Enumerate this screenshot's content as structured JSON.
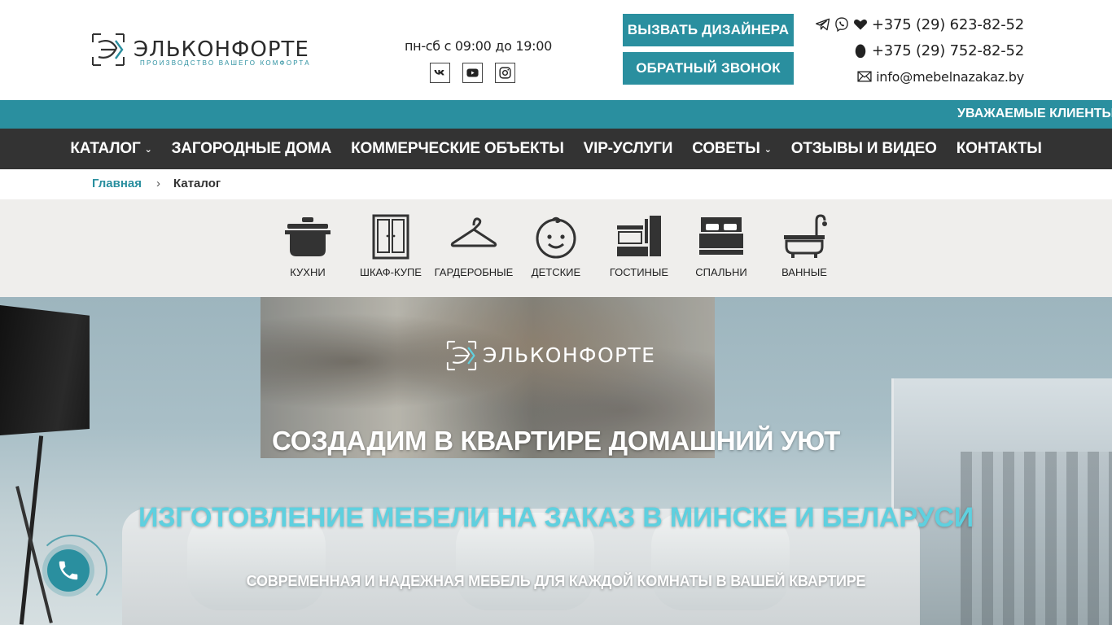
{
  "header": {
    "logo_name": "ЭЛЬКОНФОРТЕ",
    "logo_tagline": "ПРОИЗВОДСТВО ВАШЕГО КОМФОРТА",
    "hours": "пн-сб с 09:00 до 19:00",
    "socials": [
      "vk-icon",
      "youtube-icon",
      "instagram-icon"
    ],
    "cta_designer": "ВЫЗВАТЬ ДИЗАЙНЕРА",
    "cta_callback": "ОБРАТНЫЙ ЗВОНОК",
    "phone1": "+375 (29) 623-82-52",
    "phone2": "+375 (29) 752-82-52",
    "email": "info@mebelnazakaz.by",
    "phone1_icons": [
      "telegram-icon",
      "viber-icon",
      "vodafone-mts-icon"
    ],
    "phone2_icons": [
      "life-operator-icon"
    ],
    "email_icon": "envelope-icon"
  },
  "ticker": {
    "text": "УВАЖАЕМЫЕ КЛИЕНТЫ"
  },
  "nav": {
    "items": [
      {
        "label": "КАТАЛОГ",
        "dropdown": true
      },
      {
        "label": "ЗАГОРОДНЫЕ ДОМА",
        "dropdown": false
      },
      {
        "label": "КОММЕРЧЕСКИЕ ОБЪЕКТЫ",
        "dropdown": false
      },
      {
        "label": "VIP-УСЛУГИ",
        "dropdown": false
      },
      {
        "label": "СОВЕТЫ",
        "dropdown": true
      },
      {
        "label": "ОТЗЫВЫ И ВИДЕО",
        "dropdown": false
      },
      {
        "label": "КОНТАКТЫ",
        "dropdown": false
      }
    ]
  },
  "breadcrumb": {
    "home": "Главная",
    "current": "Каталог"
  },
  "categories": [
    {
      "label": "КУХНИ",
      "icon": "pot-icon"
    },
    {
      "label": "ШКАФ-КУПЕ",
      "icon": "wardrobe-icon"
    },
    {
      "label": "ГАРДЕРОБНЫЕ",
      "icon": "hanger-icon"
    },
    {
      "label": "ДЕТСКИЕ",
      "icon": "baby-face-icon"
    },
    {
      "label": "ГОСТИНЫЕ",
      "icon": "tv-wall-icon"
    },
    {
      "label": "СПАЛЬНИ",
      "icon": "bed-icon"
    },
    {
      "label": "ВАННЫЕ",
      "icon": "bathtub-icon"
    }
  ],
  "hero": {
    "logo_name": "ЭЛЬКОНФОРТЕ",
    "title": "СОЗДАДИМ В КВАРТИРЕ ДОМАШНИЙ УЮТ",
    "subtitle": "ИЗГОТОВЛЕНИЕ МЕБЕЛИ НА ЗАКАЗ В МИНСКЕ И БЕЛАРУСИ",
    "description": "СОВРЕМЕННАЯ И НАДЕЖНАЯ МЕБЕЛЬ ДЛЯ КАЖДОЙ КОМНАТЫ В ВАШЕЙ КВАРТИРЕ"
  },
  "colors": {
    "accent": "#2a8f9f",
    "nav_bg": "#333333",
    "hero_sub": "#5fd0df"
  },
  "call_button": {
    "icon": "phone-icon"
  }
}
